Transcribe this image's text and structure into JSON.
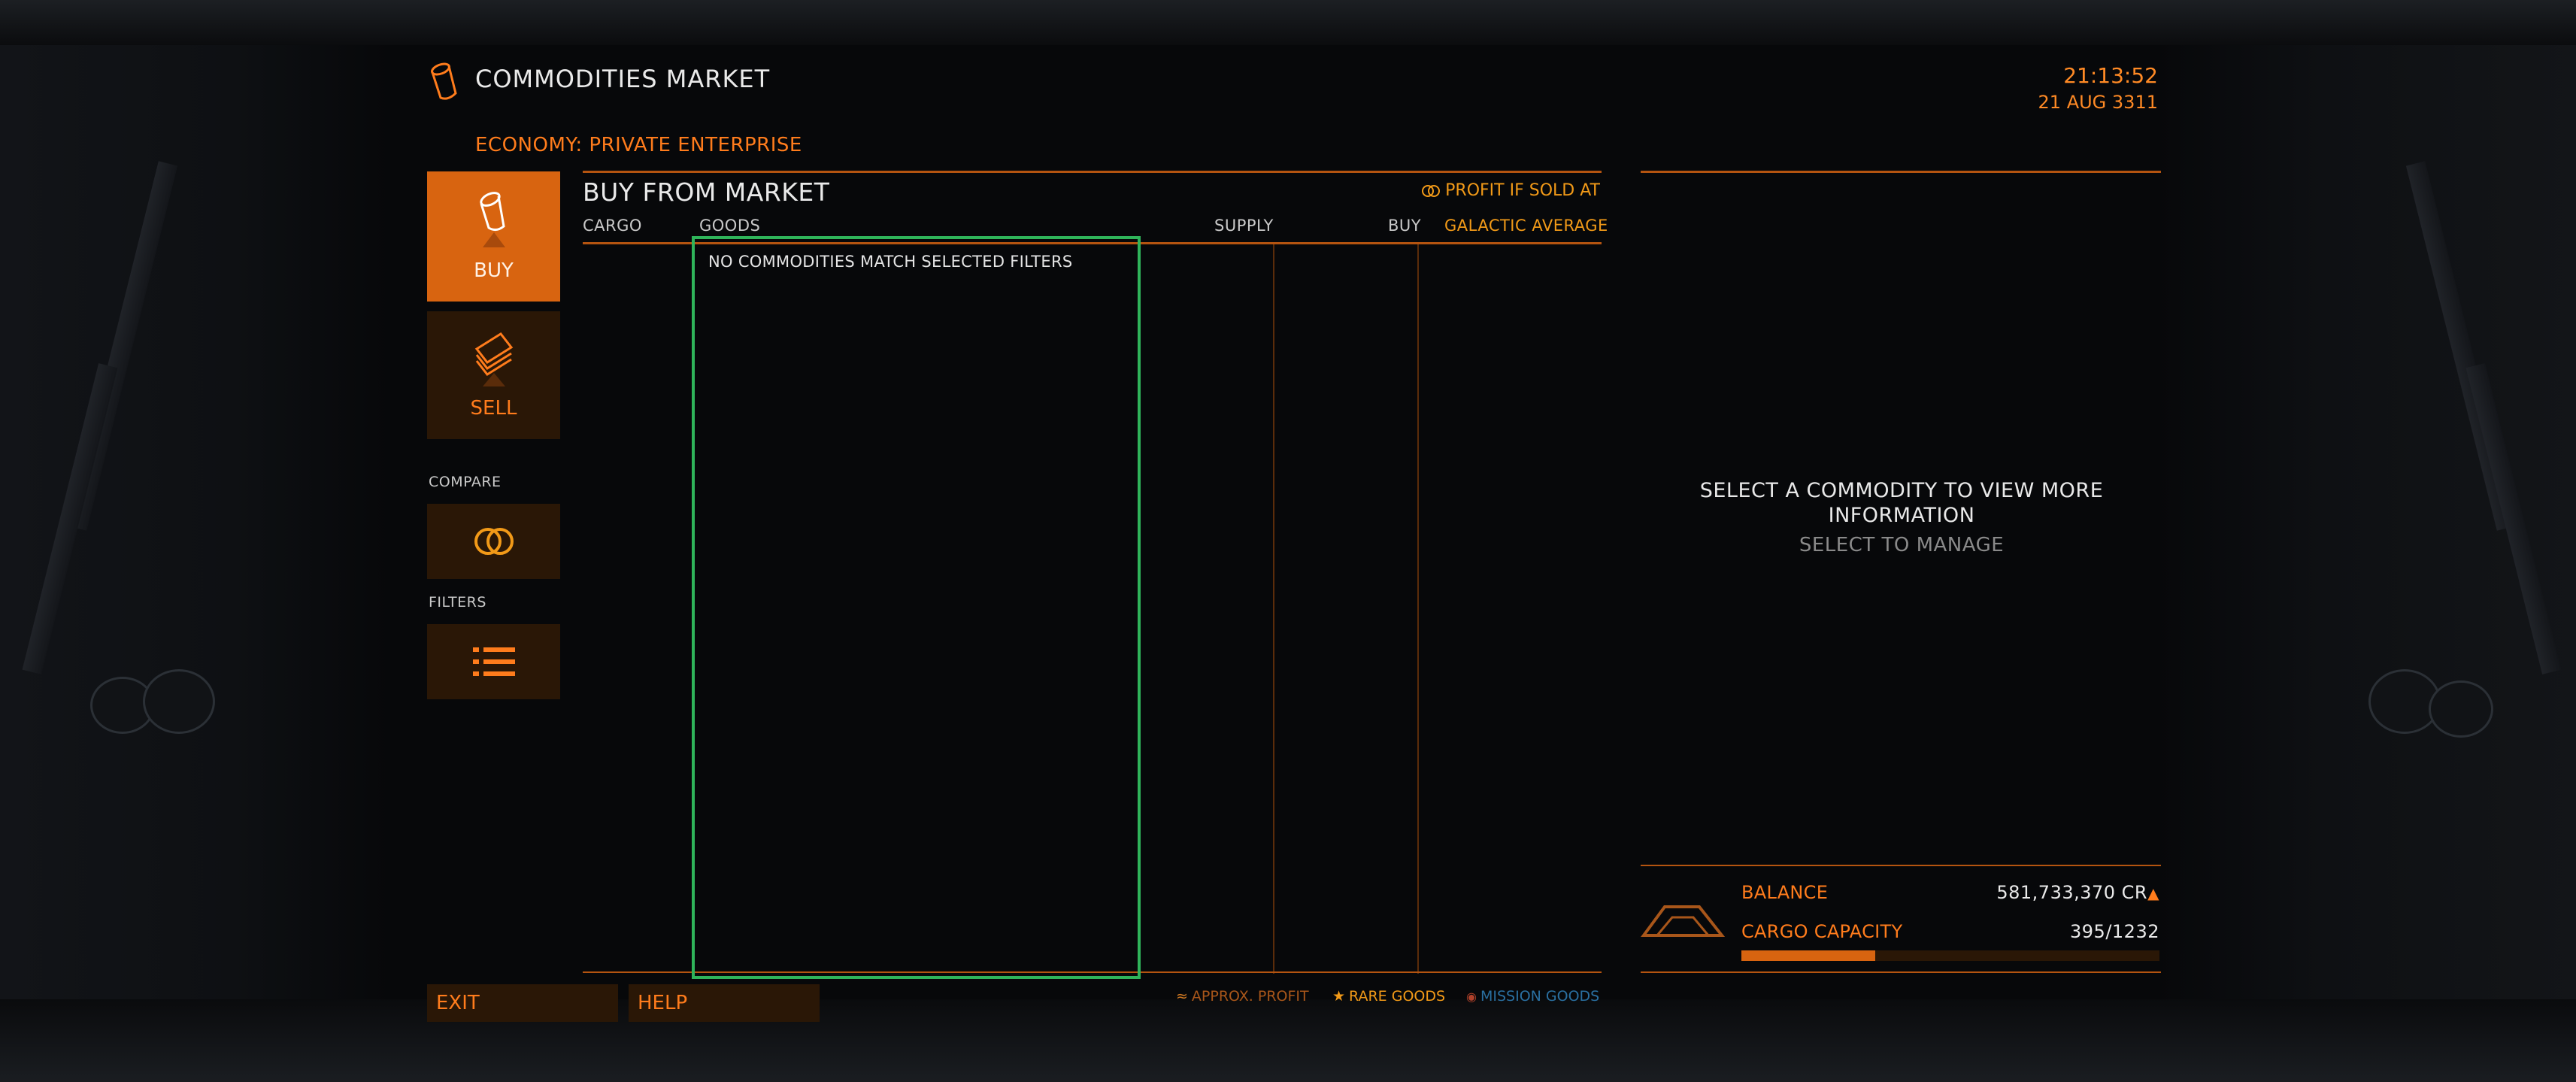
{
  "header": {
    "title": "COMMODITIES MARKET",
    "time": "21:13:52",
    "date": "21 AUG 3311",
    "economy": "ECONOMY: PRIVATE ENTERPRISE"
  },
  "nav": {
    "buy_label": "BUY",
    "sell_label": "SELL",
    "compare_label": "COMPARE",
    "filters_label": "FILTERS"
  },
  "market": {
    "title": "BUY FROM MARKET",
    "profit_label": "PROFIT IF SOLD AT",
    "columns": {
      "cargo": "CARGO",
      "goods": "GOODS",
      "supply": "SUPPLY",
      "buy": "BUY",
      "galactic_average": "GALACTIC AVERAGE"
    },
    "empty_message": "NO COMMODITIES MATCH SELECTED FILTERS"
  },
  "footer": {
    "exit_label": "EXIT",
    "help_label": "HELP",
    "legend": {
      "approx_profit": "APPROX. PROFIT",
      "rare_goods": "RARE GOODS",
      "mission_goods": "MISSION GOODS"
    }
  },
  "info": {
    "prompt": "SELECT A COMMODITY TO VIEW MORE INFORMATION",
    "sub": "SELECT TO MANAGE"
  },
  "stats": {
    "balance_label": "BALANCE",
    "balance_value": "581,733,370 CR",
    "cargo_label": "CARGO CAPACITY",
    "cargo_value": "395/1232",
    "cargo_fill_fraction": 0.32
  },
  "colors": {
    "accent": "#ff7c1c",
    "accent_dark": "#d86410",
    "gold": "#f29a18",
    "mission_blue": "#2a6fa0",
    "highlight_green": "#2fb45a"
  }
}
